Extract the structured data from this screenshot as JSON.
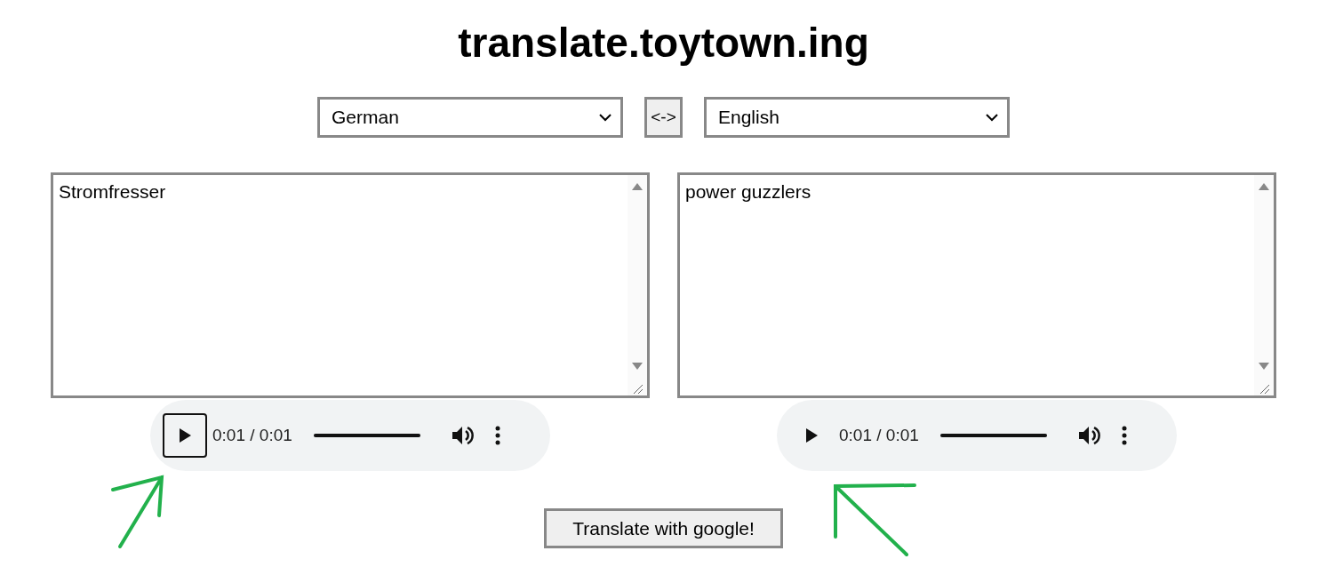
{
  "title": "translate.toytown.ing",
  "source_language": "German",
  "swap_button": "<->",
  "target_language": "English",
  "panels": [
    {
      "text": "Stromfresser",
      "player": {
        "time": "0:01 / 0:01",
        "level": 1,
        "play_focused": true
      }
    },
    {
      "text": "power guzzlers",
      "player": {
        "time": "0:01 / 0:01",
        "level": 1,
        "play_focused": false
      }
    }
  ],
  "translate_button": "Translate with google!"
}
